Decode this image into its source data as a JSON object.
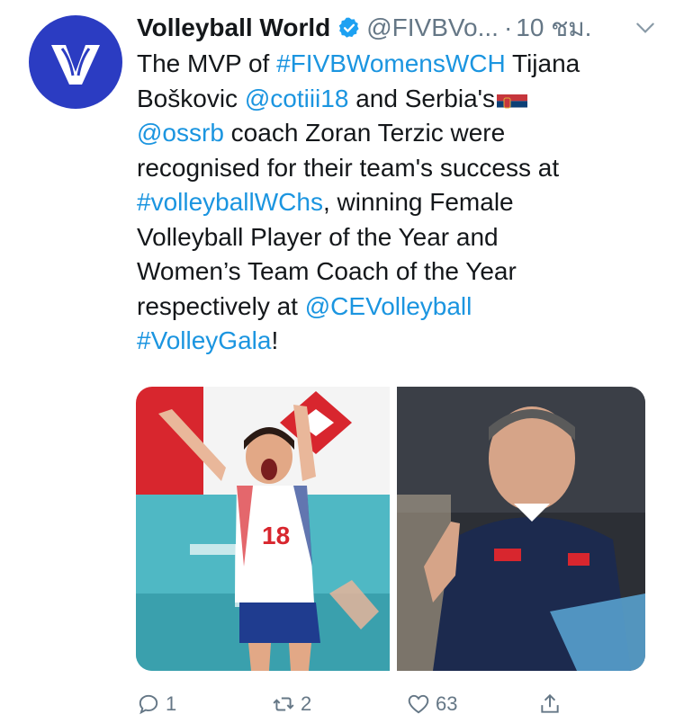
{
  "tweet": {
    "display_name": "Volleyball World",
    "handle": "@FIVBVo...",
    "separator": "·",
    "time": "10 ชม.",
    "lines": [
      [
        {
          "t": "The MVP of ",
          "l": false
        },
        {
          "t": "#FIVBWomensWCH",
          "l": true
        },
        {
          "t": " Tijana",
          "l": false
        }
      ],
      [
        {
          "t": "Boškovic ",
          "l": false
        },
        {
          "t": "@cotiii18",
          "l": true
        },
        {
          "t": "  and Serbia's",
          "l": false
        }
      ],
      [
        {
          "t": "@ossrb",
          "l": true
        },
        {
          "t": " coach Zoran Terzic were",
          "l": false
        }
      ],
      [
        {
          "t": "recognised for their team's success at",
          "l": false
        }
      ],
      [
        {
          "t": "#volleyballWChs",
          "l": true
        },
        {
          "t": ", winning Female",
          "l": false
        }
      ],
      [
        {
          "t": "Volleyball Player of the Year and",
          "l": false
        }
      ],
      [
        {
          "t": "Women’s Team Coach of the Year",
          "l": false
        }
      ],
      [
        {
          "t": "respectively at ",
          "l": false
        },
        {
          "t": "@CEVolleyball",
          "l": true
        }
      ],
      [
        {
          "t": "#VolleyGala",
          "l": true
        },
        {
          "t": "!",
          "l": false
        }
      ]
    ],
    "flag_emoji": "serbia-flag"
  },
  "actions": {
    "reply_count": "1",
    "retweet_count": "2",
    "like_count": "63",
    "share_icon": "share-icon"
  },
  "colors": {
    "link": "#1b95e0",
    "muted": "#657786",
    "brand": "#2b3cc2"
  }
}
